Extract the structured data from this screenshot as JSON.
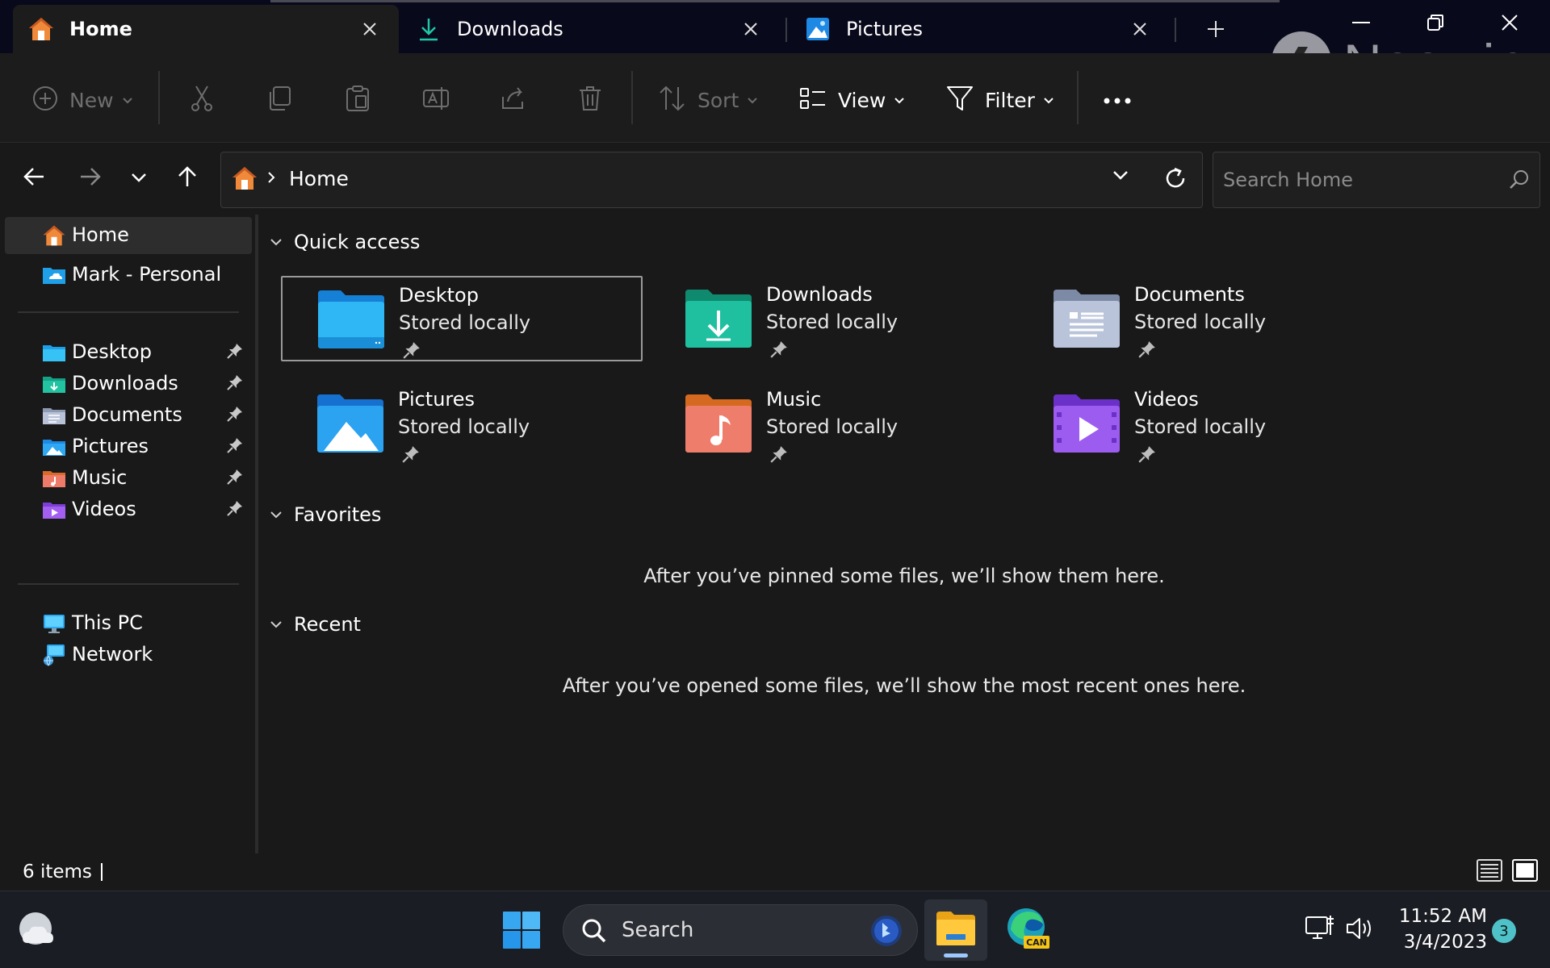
{
  "tabs": [
    {
      "label": "Home",
      "icon": "home-icon",
      "active": true
    },
    {
      "label": "Downloads",
      "icon": "download-icon",
      "active": false
    },
    {
      "label": "Pictures",
      "icon": "pictures-icon",
      "active": false
    }
  ],
  "watermark": {
    "text": "Neowin"
  },
  "toolbar": {
    "new_label": "New",
    "sort_label": "Sort",
    "view_label": "View",
    "filter_label": "Filter"
  },
  "address": {
    "path": "Home",
    "search_placeholder": "Search Home"
  },
  "sidebar": {
    "top_items": [
      {
        "label": "Home",
        "icon": "home-icon"
      },
      {
        "label": "Mark - Personal",
        "icon": "onedrive-icon"
      }
    ],
    "pinned_items": [
      {
        "label": "Desktop",
        "icon": "desktop-folder-icon"
      },
      {
        "label": "Downloads",
        "icon": "downloads-folder-icon"
      },
      {
        "label": "Documents",
        "icon": "documents-folder-icon"
      },
      {
        "label": "Pictures",
        "icon": "pictures-folder-icon"
      },
      {
        "label": "Music",
        "icon": "music-folder-icon"
      },
      {
        "label": "Videos",
        "icon": "videos-folder-icon"
      }
    ],
    "bottom_items": [
      {
        "label": "This PC",
        "icon": "this-pc-icon"
      },
      {
        "label": "Network",
        "icon": "network-icon"
      }
    ]
  },
  "main": {
    "quick_access_title": "Quick access",
    "quick_access": [
      {
        "name": "Desktop",
        "status": "Stored locally"
      },
      {
        "name": "Downloads",
        "status": "Stored locally"
      },
      {
        "name": "Documents",
        "status": "Stored locally"
      },
      {
        "name": "Pictures",
        "status": "Stored locally"
      },
      {
        "name": "Music",
        "status": "Stored locally"
      },
      {
        "name": "Videos",
        "status": "Stored locally"
      }
    ],
    "favorites_title": "Favorites",
    "favorites_empty": "After you’ve pinned some files, we’ll show them here.",
    "recent_title": "Recent",
    "recent_empty": "After you’ve opened some files, we’ll show the most recent ones here."
  },
  "status": {
    "item_count": "6 items"
  },
  "taskbar": {
    "search_label": "Search",
    "time": "11:52 AM",
    "date": "3/4/2023",
    "notification_count": "3",
    "edge_badge": "CAN"
  },
  "colors": {
    "titlebar": "#09091c",
    "background": "#191919",
    "accent_folder_blue": "#1e9fe8",
    "accent_home_orange": "#f08a3a"
  }
}
